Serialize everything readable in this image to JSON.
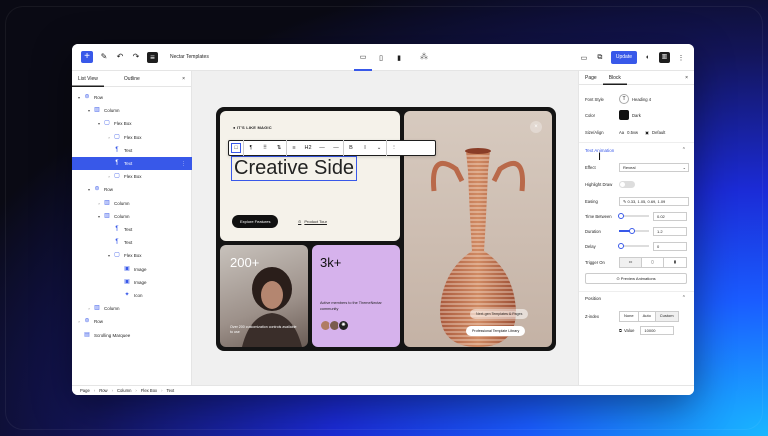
{
  "colors": {
    "accent": "#3858e9",
    "lavender": "#d6b2ec",
    "cream": "#f5f2ea",
    "dark": "#141414"
  },
  "topbar": {
    "site_title": "Nectar Templates",
    "update_label": "Update",
    "icons": [
      "plus-icon",
      "brush-icon",
      "undo-icon",
      "redo-icon",
      "list-view-icon",
      "desktop-icon",
      "tablet-icon",
      "mobile-icon",
      "sparkle-icon",
      "view-icon",
      "external-icon",
      "contrast-icon",
      "sidebar-icon",
      "more-icon"
    ]
  },
  "left_panel": {
    "tabs": [
      "List View",
      "Outline"
    ],
    "close": "×",
    "tree": [
      {
        "label": "Row",
        "depth": 0,
        "chev": "▾",
        "icon": "⊜"
      },
      {
        "label": "Column",
        "depth": 1,
        "chev": "▾",
        "icon": "▥"
      },
      {
        "label": "Flex Box",
        "depth": 2,
        "chev": "▾",
        "icon": "▢"
      },
      {
        "label": "Flex Box",
        "depth": 3,
        "chev": "›",
        "icon": "▢"
      },
      {
        "label": "Text",
        "depth": 3,
        "chev": "",
        "icon": "¶"
      },
      {
        "label": "Text",
        "depth": 3,
        "chev": "",
        "icon": "¶",
        "selected": true
      },
      {
        "label": "Flex Box",
        "depth": 3,
        "chev": "›",
        "icon": "▢"
      },
      {
        "label": "Row",
        "depth": 1,
        "chev": "▾",
        "icon": "⊜"
      },
      {
        "label": "Column",
        "depth": 2,
        "chev": "›",
        "icon": "▥"
      },
      {
        "label": "Column",
        "depth": 2,
        "chev": "▾",
        "icon": "▥"
      },
      {
        "label": "Text",
        "depth": 3,
        "chev": "",
        "icon": "¶"
      },
      {
        "label": "Text",
        "depth": 3,
        "chev": "",
        "icon": "¶"
      },
      {
        "label": "Flex Box",
        "depth": 3,
        "chev": "▾",
        "icon": "▢"
      },
      {
        "label": "Image",
        "depth": 4,
        "chev": "",
        "icon": "▣"
      },
      {
        "label": "Image",
        "depth": 4,
        "chev": "",
        "icon": "▣"
      },
      {
        "label": "Icon",
        "depth": 4,
        "chev": "",
        "icon": "✦"
      },
      {
        "label": "Column",
        "depth": 1,
        "chev": "›",
        "icon": "▥"
      },
      {
        "label": "Row",
        "depth": 0,
        "chev": "›",
        "icon": "⊜"
      },
      {
        "label": "Scrolling Marquee",
        "depth": 0,
        "chev": "",
        "icon": "▤"
      }
    ]
  },
  "canvas": {
    "kicker": "IT'S LIKE MAGIC",
    "headline": "Creative Side",
    "explore_label": "Explore Features",
    "tour_label": "Product Tour",
    "toolbar": [
      "□",
      "¶",
      "⠿",
      "⇅",
      "≡",
      "H2",
      "—",
      "—",
      "B",
      "I",
      "⌄",
      "⋮"
    ],
    "portrait_number": "200+",
    "portrait_text": "Over 200 customization controls available to use",
    "stats_number": "3k+",
    "stats_text": "Active members to the ThemeNectar community",
    "pill_faded": "Next-gen Templates & Pages",
    "pill_main": "Professional Template Library"
  },
  "right_panel": {
    "tabs": [
      "Page",
      "Block"
    ],
    "close": "×",
    "font_style_label": "Font Style",
    "font_style_value": "Heading 4",
    "color_label": "Color",
    "color_value": "Dark",
    "size_label": "Size/Align",
    "size_value": "0.5vw",
    "align_value": "Default",
    "text_animation": "Text Animation",
    "effect_label": "Effect",
    "effect_value": "Reveal",
    "highlight_label": "Highlight Draw",
    "easing_label": "Easing",
    "easing_value": "0.33, 1.05, 0.69, 1.09",
    "time_between_label": "Time Between",
    "time_between_value": "0.02",
    "duration_label": "Duration",
    "duration_value": "1.2",
    "delay_label": "Delay",
    "delay_value": "0",
    "trigger_label": "Trigger On",
    "preview_label": "Preview Animations",
    "position_label": "Position",
    "zindex_label": "Z-index",
    "zindex_options": [
      "None",
      "Auto",
      "Custom"
    ],
    "value_label": "Value",
    "value_value": "10000"
  },
  "breadcrumb": [
    "Page",
    "Row",
    "Column",
    "Flex Box",
    "Text"
  ]
}
